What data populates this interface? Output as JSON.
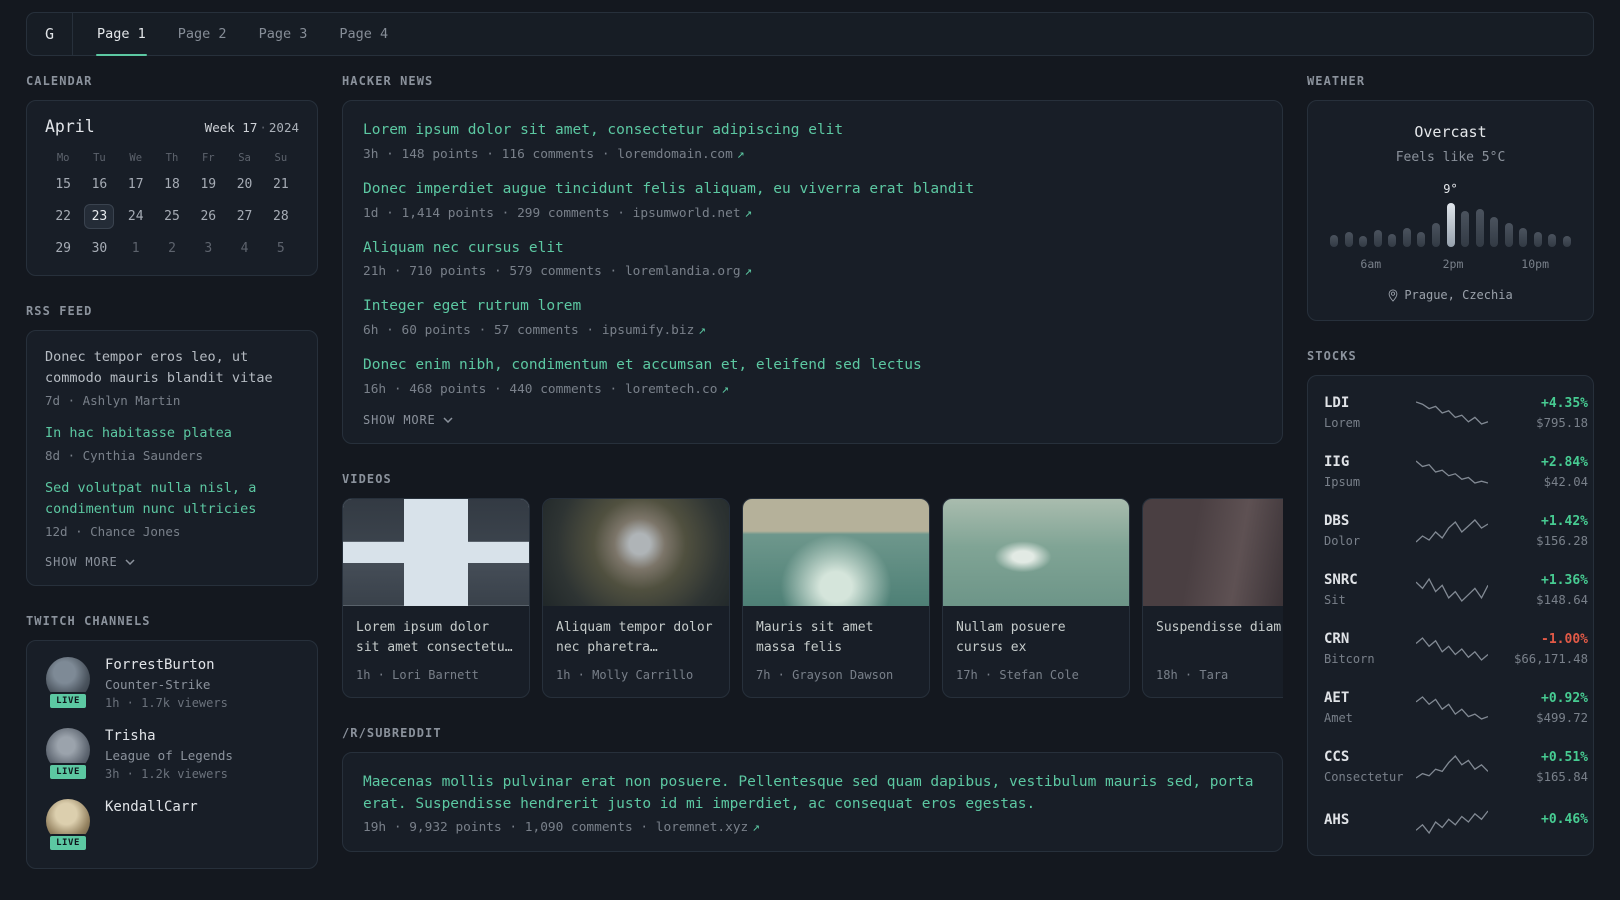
{
  "icons": {
    "external_link": "↗"
  },
  "topbar": {
    "logo": "G",
    "tabs": [
      {
        "label": "Page 1",
        "active": true
      },
      {
        "label": "Page 2",
        "active": false
      },
      {
        "label": "Page 3",
        "active": false
      },
      {
        "label": "Page 4",
        "active": false
      }
    ]
  },
  "calendar": {
    "widget_title": "CALENDAR",
    "month": "April",
    "week_label": "Week 17",
    "separator": "·",
    "year": "2024",
    "day_headers": [
      "Mo",
      "Tu",
      "We",
      "Th",
      "Fr",
      "Sa",
      "Su"
    ],
    "cells": [
      {
        "label": "15",
        "state": "normal"
      },
      {
        "label": "16",
        "state": "normal"
      },
      {
        "label": "17",
        "state": "normal"
      },
      {
        "label": "18",
        "state": "normal"
      },
      {
        "label": "19",
        "state": "normal"
      },
      {
        "label": "20",
        "state": "normal"
      },
      {
        "label": "21",
        "state": "normal"
      },
      {
        "label": "22",
        "state": "normal"
      },
      {
        "label": "23",
        "state": "selected"
      },
      {
        "label": "24",
        "state": "normal"
      },
      {
        "label": "25",
        "state": "normal"
      },
      {
        "label": "26",
        "state": "normal"
      },
      {
        "label": "27",
        "state": "normal"
      },
      {
        "label": "28",
        "state": "normal"
      },
      {
        "label": "29",
        "state": "normal"
      },
      {
        "label": "30",
        "state": "normal"
      },
      {
        "label": "1",
        "state": "outside"
      },
      {
        "label": "2",
        "state": "outside"
      },
      {
        "label": "3",
        "state": "outside"
      },
      {
        "label": "4",
        "state": "outside"
      },
      {
        "label": "5",
        "state": "outside"
      }
    ]
  },
  "rss": {
    "widget_title": "RSS FEED",
    "show_more": "SHOW MORE",
    "items": [
      {
        "title": "Donec tempor eros leo, ut commodo mauris blandit vitae",
        "meta": "7d · Ashlyn Martin",
        "visited": true
      },
      {
        "title": "In hac habitasse platea",
        "meta": "8d · Cynthia Saunders",
        "visited": false
      },
      {
        "title": "Sed volutpat nulla nisl, a condimentum nunc ultricies",
        "meta": "12d · Chance Jones",
        "visited": false
      }
    ]
  },
  "twitch": {
    "widget_title": "TWITCH CHANNELS",
    "channels": [
      {
        "name": "ForrestBurton",
        "game": "Counter-Strike",
        "meta": "1h · 1.7k viewers",
        "live": "LIVE"
      },
      {
        "name": "Trisha",
        "game": "League of Legends",
        "meta": "3h · 1.2k viewers",
        "live": "LIVE"
      },
      {
        "name": "KendallCarr",
        "game": "",
        "meta": "",
        "live": "LIVE"
      }
    ]
  },
  "hackernews": {
    "widget_title": "HACKER NEWS",
    "show_more": "SHOW MORE",
    "items": [
      {
        "title": "Lorem ipsum dolor sit amet, consectetur adipiscing elit",
        "meta": "3h · 148 points · 116 comments · ",
        "domain": "loremdomain.com"
      },
      {
        "title": "Donec imperdiet augue tincidunt felis aliquam, eu viverra erat blandit",
        "meta": "1d · 1,414 points · 299 comments · ",
        "domain": "ipsumworld.net"
      },
      {
        "title": "Aliquam nec cursus elit",
        "meta": "21h · 710 points · 579 comments · ",
        "domain": "loremlandia.org"
      },
      {
        "title": "Integer eget rutrum lorem",
        "meta": "6h · 60 points · 57 comments · ",
        "domain": "ipsumify.biz"
      },
      {
        "title": "Donec enim nibh, condimentum et accumsan et, eleifend sed lectus",
        "meta": "16h · 468 points · 440 comments · ",
        "domain": "loremtech.co"
      }
    ]
  },
  "videos": {
    "widget_title": "VIDEOS",
    "items": [
      {
        "title": "Lorem ipsum dolor sit amet consectetu…",
        "meta": "1h · Lori Barnett"
      },
      {
        "title": "Aliquam tempor dolor nec pharetra…",
        "meta": "1h · Molly Carrillo"
      },
      {
        "title": "Mauris sit amet massa felis",
        "meta": "7h · Grayson Dawson"
      },
      {
        "title": "Nullam posuere cursus ex",
        "meta": "17h · Stefan Cole"
      },
      {
        "title": "Suspendisse diam",
        "meta": "18h · Tara"
      }
    ]
  },
  "subreddit": {
    "widget_title": "/R/SUBREDDIT",
    "items": [
      {
        "title": "Maecenas mollis pulvinar erat non posuere. Pellentesque sed quam dapibus, vestibulum mauris sed, porta erat. Suspendisse hendrerit justo id mi imperdiet, ac consequat eros egestas.",
        "meta": "19h · 9,932 points · 1,090 comments · ",
        "domain": "loremnet.xyz"
      }
    ]
  },
  "weather": {
    "widget_title": "WEATHER",
    "condition": "Overcast",
    "feels_like": "Feels like 5°C",
    "peak_label": "9°",
    "highlight_index": 8,
    "bars": [
      12,
      15,
      11,
      17,
      13,
      19,
      15,
      24,
      44,
      36,
      38,
      30,
      24,
      19,
      15,
      13,
      11
    ],
    "time_labels": [
      "6am",
      "2pm",
      "10pm"
    ],
    "location": "Prague, Czechia"
  },
  "stocks": {
    "widget_title": "STOCKS",
    "items": [
      {
        "ticker": "LDI",
        "name": "Lorem",
        "change": "+4.35%",
        "price": "$795.18",
        "spark": [
          16,
          15,
          13,
          14,
          11,
          12,
          9,
          10,
          7,
          9,
          6,
          7
        ]
      },
      {
        "ticker": "IIG",
        "name": "Ipsum",
        "change": "+2.84%",
        "price": "$42.04",
        "spark": [
          17,
          14,
          15,
          11,
          12,
          9,
          10,
          7,
          8,
          5,
          6,
          5
        ]
      },
      {
        "ticker": "DBS",
        "name": "Dolor",
        "change": "+1.42%",
        "price": "$156.28",
        "spark": [
          5,
          8,
          6,
          10,
          7,
          12,
          15,
          10,
          13,
          16,
          12,
          14
        ]
      },
      {
        "ticker": "SNRC",
        "name": "Sit",
        "change": "+1.36%",
        "price": "$148.64",
        "spark": [
          12,
          10,
          13,
          9,
          11,
          7,
          9,
          6,
          8,
          10,
          7,
          11
        ]
      },
      {
        "ticker": "CRN",
        "name": "Bitcorn",
        "change": "-1.00%",
        "price": "$66,171.48",
        "spark": [
          13,
          15,
          12,
          14,
          10,
          12,
          9,
          11,
          8,
          10,
          7,
          9
        ]
      },
      {
        "ticker": "AET",
        "name": "Amet",
        "change": "+0.92%",
        "price": "$499.72",
        "spark": [
          14,
          16,
          13,
          15,
          11,
          13,
          9,
          11,
          8,
          9,
          7,
          8
        ]
      },
      {
        "ticker": "CCS",
        "name": "Consectetur",
        "change": "+0.51%",
        "price": "$165.84",
        "spark": [
          6,
          8,
          7,
          10,
          9,
          13,
          16,
          12,
          14,
          10,
          12,
          9
        ]
      },
      {
        "ticker": "AHS",
        "name": "",
        "change": "+0.46%",
        "price": "",
        "spark": [
          9,
          11,
          8,
          12,
          10,
          13,
          11,
          14,
          12,
          15,
          13,
          16
        ]
      }
    ]
  }
}
